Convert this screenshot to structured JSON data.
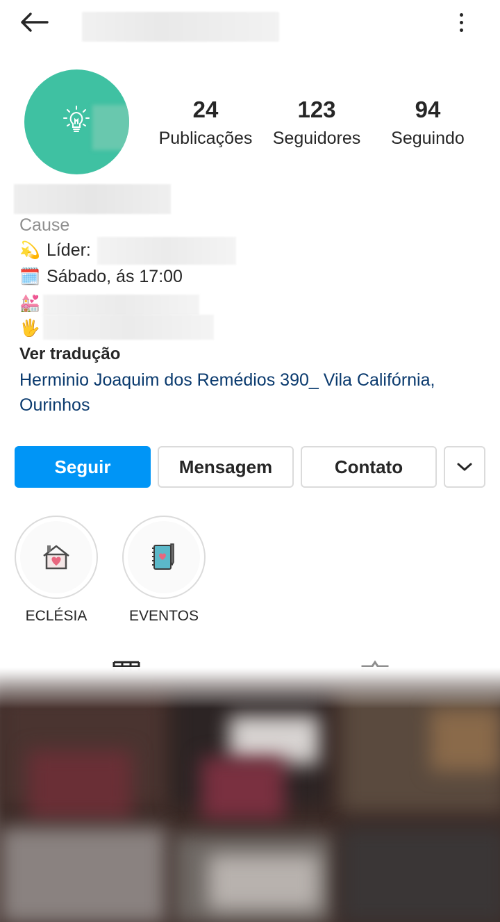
{
  "header": {
    "back_icon": "arrow-left-icon",
    "more_icon": "more-vertical-icon"
  },
  "stats": [
    {
      "count": "24",
      "label": "Publicações"
    },
    {
      "count": "123",
      "label": "Seguidores"
    },
    {
      "count": "94",
      "label": "Seguindo"
    }
  ],
  "bio": {
    "category": "Cause",
    "line1_emoji": "💫",
    "line1_text": "Líder:",
    "line2_emoji": "🗓️",
    "line2_text": "Sábado, ás 17:00",
    "line3_emoji": "💒",
    "line4_emoji": "🖐",
    "translate": "Ver tradução",
    "address": "Herminio Joaquim dos Remédios 390_ Vila Califórnia, Ourinhos"
  },
  "actions": {
    "follow": "Seguir",
    "message": "Mensagem",
    "contact": "Contato",
    "more_icon": "chevron-down-icon"
  },
  "highlights": [
    {
      "label": "ECLÉSIA",
      "icon": "house-heart-icon"
    },
    {
      "label": "EVENTOS",
      "icon": "notebook-heart-icon"
    }
  ],
  "tabs": [
    {
      "icon": "grid-icon"
    },
    {
      "icon": "tagged-icon"
    }
  ],
  "colors": {
    "follow_button": "#0095f6",
    "avatar_bg": "#3fc1a2",
    "address_link": "#0a3a6e",
    "category_text": "#8e8e8e"
  }
}
